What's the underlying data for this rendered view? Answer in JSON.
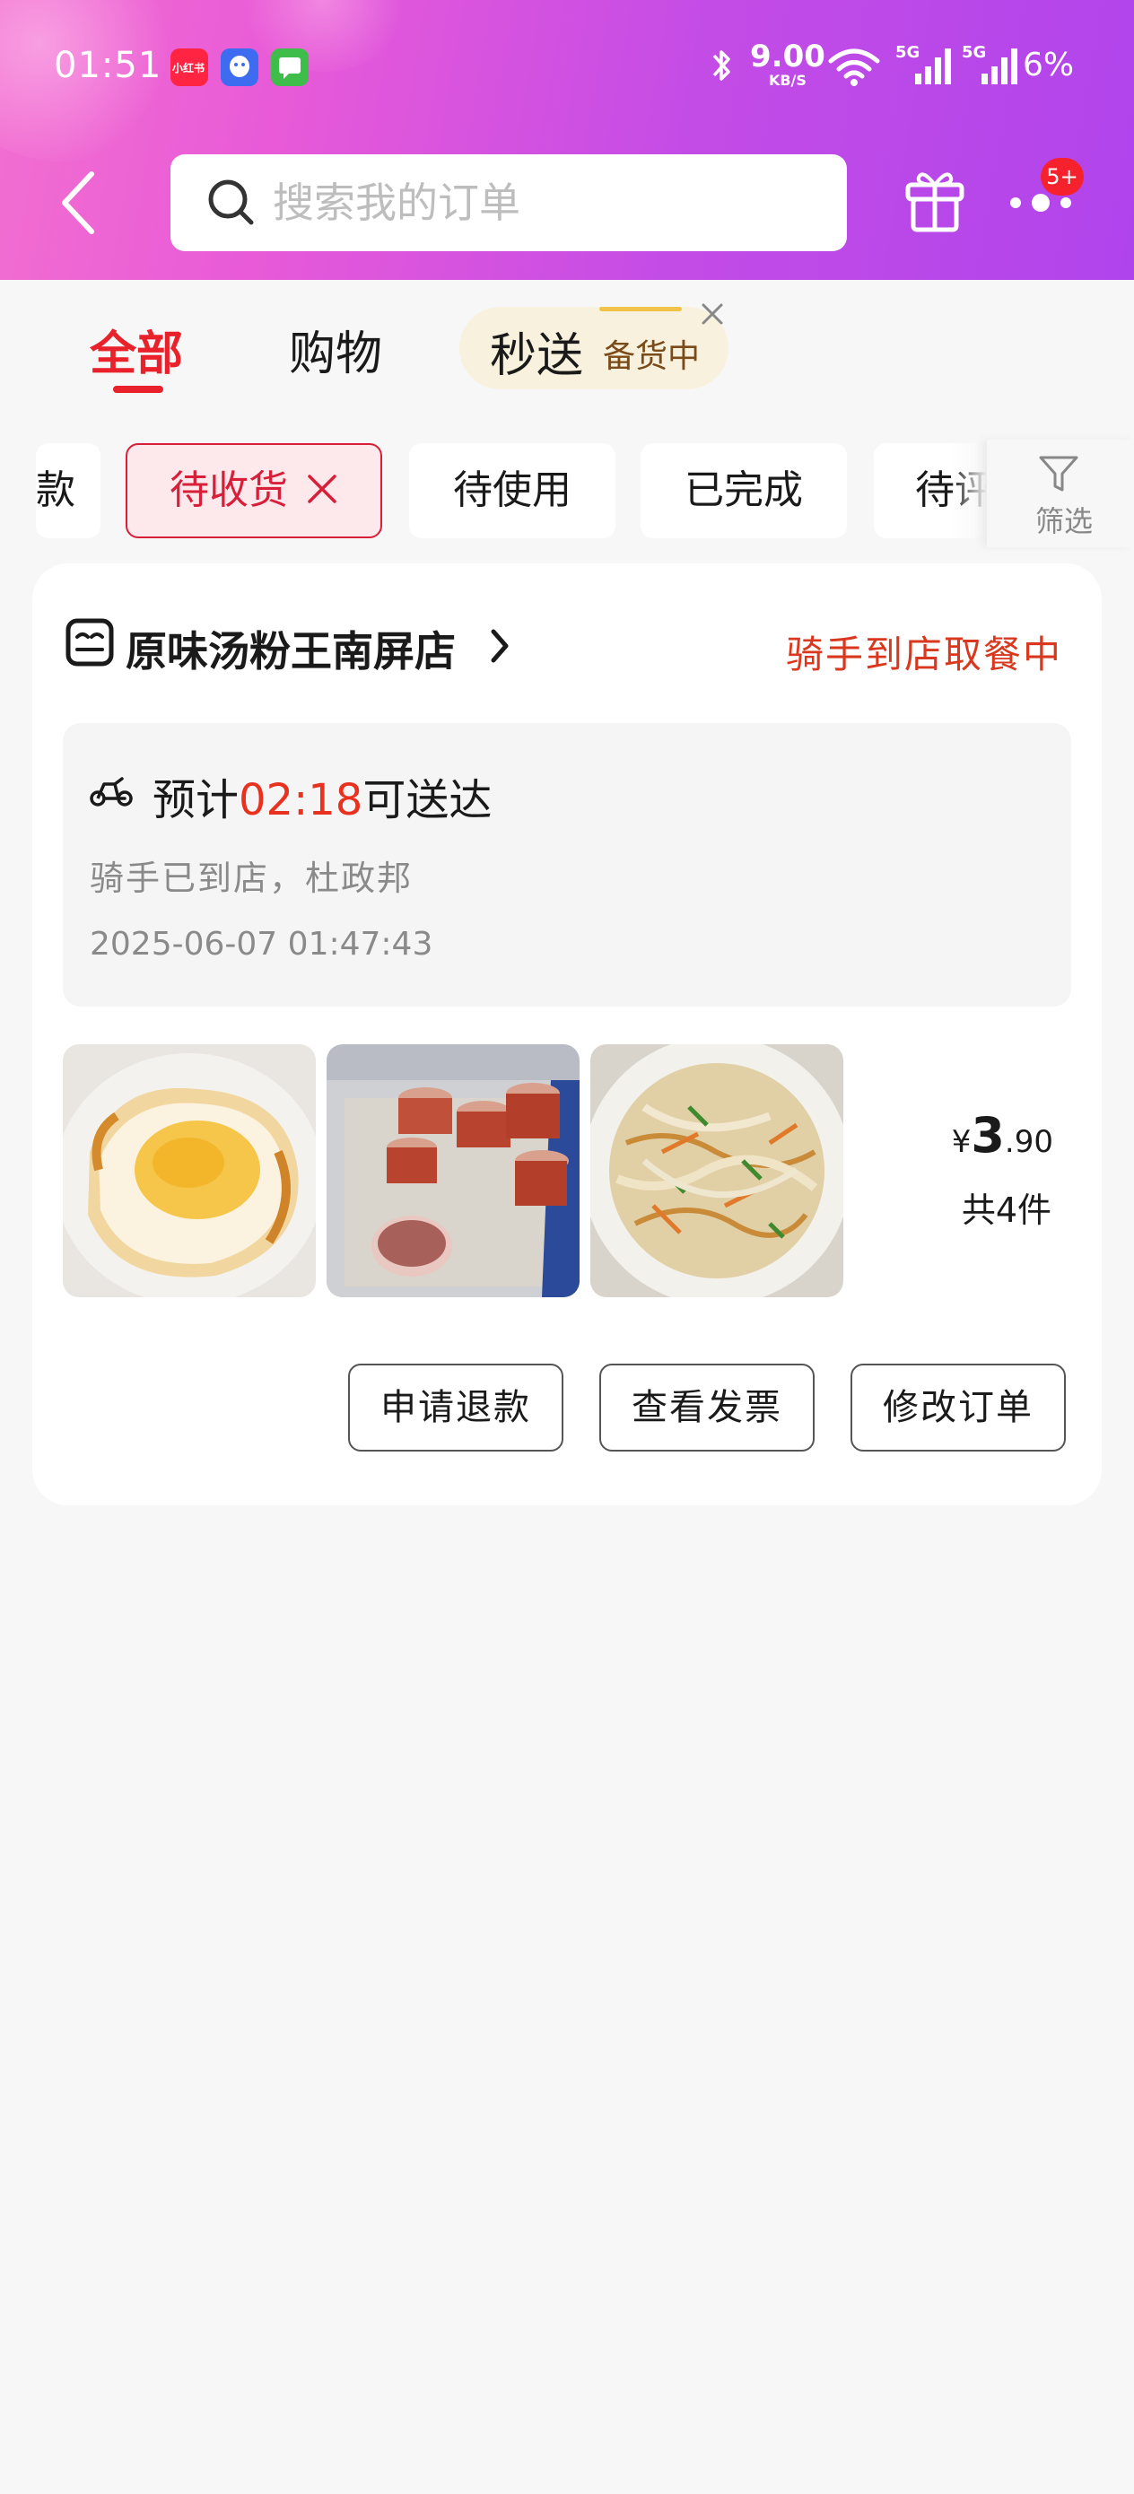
{
  "status_bar": {
    "time": "01:51",
    "apps": [
      {
        "name": "xiaohongshu",
        "label": "小红书",
        "color": "#ff2442"
      },
      {
        "name": "qq",
        "color": "#3d6cf0"
      },
      {
        "name": "messages",
        "color": "#3fbd4a"
      }
    ],
    "net_speed_value": "9.00",
    "net_speed_unit": "KB/S",
    "signal1": "5G",
    "signal2": "5G",
    "battery": "6%"
  },
  "header": {
    "search_placeholder": "搜索我的订单",
    "more_badge": "5+",
    "gradient_colors": [
      "#f26fd0",
      "#b044ec"
    ]
  },
  "top_tabs": [
    {
      "label": "全部",
      "active": true
    },
    {
      "label": "购物",
      "active": false
    },
    {
      "label": "秒送",
      "sub": "备货中",
      "active": false
    }
  ],
  "filters": {
    "chips": [
      {
        "label": "款",
        "active": false
      },
      {
        "label": "待收货",
        "active": true
      },
      {
        "label": "待使用",
        "active": false
      },
      {
        "label": "已完成",
        "active": false
      },
      {
        "label": "待评",
        "active": false
      }
    ],
    "filter_label": "筛选"
  },
  "order": {
    "store_name": "原味汤粉王南屏店",
    "status": "骑手到店取餐中",
    "eta_prefix": "预计",
    "eta_time": "02:18",
    "eta_suffix": "可送达",
    "rider_info": "骑手已到店，杜政邦",
    "order_time": "2025-06-07 01:47:43",
    "products": [
      {
        "name": "fried-egg"
      },
      {
        "name": "sauce-cups"
      },
      {
        "name": "stir-fried-rice-noodles"
      }
    ],
    "price_currency": "¥",
    "price_int": "3",
    "price_dec": ".90",
    "quantity": "共4件",
    "actions": [
      "申请退款",
      "查看发票",
      "修改订单"
    ]
  },
  "colors": {
    "accent_red": "#e8212a",
    "status_red": "#d9381e"
  }
}
